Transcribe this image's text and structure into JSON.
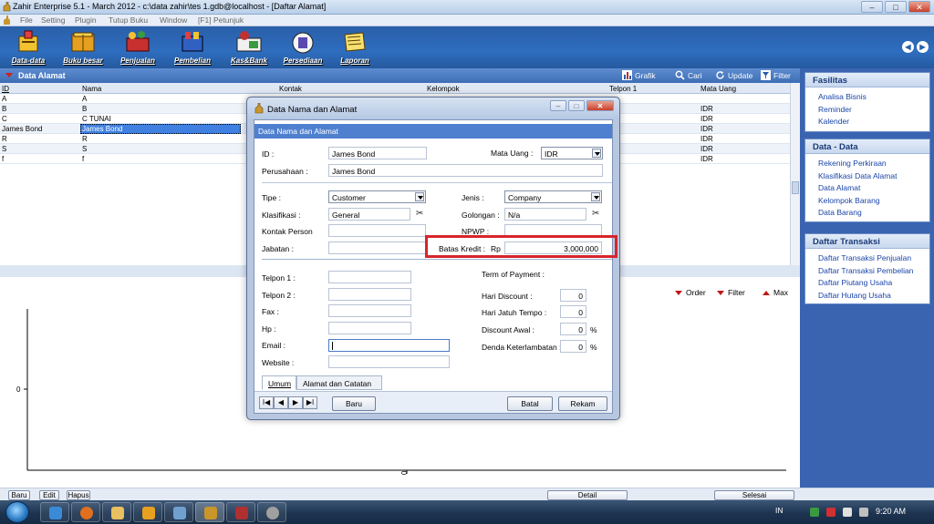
{
  "window": {
    "title": "Zahir Enterprise 5.1 - March 2012 - c:\\data zahir\\tes 1.gdb@localhost - [Daftar Alamat]"
  },
  "menu": [
    "File",
    "Setting",
    "Plugin",
    "Tutup Buku",
    "Window",
    "[F1] Petunjuk"
  ],
  "toolbar": [
    {
      "label": "Data-data",
      "icon": "data-icon"
    },
    {
      "label": "Buku besar",
      "icon": "ledger-icon"
    },
    {
      "label": "Penjualan",
      "icon": "sales-icon"
    },
    {
      "label": "Pembelian",
      "icon": "purchase-icon"
    },
    {
      "label": "Kas&Bank",
      "icon": "cash-bank-icon"
    },
    {
      "label": "Persediaan",
      "icon": "inventory-icon"
    },
    {
      "label": "Laporan",
      "icon": "report-icon"
    }
  ],
  "panel": {
    "title": "Data Alamat",
    "tools": {
      "grafik": "Grafik",
      "cari": "Cari",
      "update": "Update",
      "filter": "Filter"
    },
    "columns": [
      "ID",
      "Nama",
      "Kontak",
      "Kelompok",
      "Telpon 1",
      "Mata Uang"
    ],
    "rows": [
      {
        "id": "A",
        "nama": "A",
        "uang": ""
      },
      {
        "id": "B",
        "nama": "B",
        "uang": "IDR"
      },
      {
        "id": "C",
        "nama": "C TUNAI",
        "uang": "IDR"
      },
      {
        "id": "James Bond",
        "nama": "James Bond",
        "uang": "IDR"
      },
      {
        "id": "R",
        "nama": "R",
        "uang": "IDR"
      },
      {
        "id": "S",
        "nama": "S",
        "uang": "IDR"
      },
      {
        "id": "f",
        "nama": "f",
        "uang": "IDR"
      }
    ]
  },
  "chart": {
    "legend": {
      "order": "Order",
      "filter": "Filter",
      "max": "Max"
    },
    "y_tick": "0",
    "x_tick": "0"
  },
  "bottom": {
    "baru": "Baru",
    "edit": "Edit",
    "hapus": "Hapus",
    "detail": "Detail",
    "selesai": "Selesai"
  },
  "sidebar": {
    "fasilitas": {
      "title": "Fasilitas",
      "items": [
        "Analisa Bisnis",
        "Reminder",
        "Kalender"
      ]
    },
    "datadata": {
      "title": "Data - Data",
      "items": [
        "Rekening Perkiraan",
        "Klasifikasi Data Alamat",
        "Data Alamat",
        "Kelompok Barang",
        "Data Barang"
      ]
    },
    "transaksi": {
      "title": "Daftar Transaksi",
      "items": [
        "Daftar Transaksi Penjualan",
        "Daftar Transaksi Pembelian",
        "Daftar Piutang Usaha",
        "Daftar Hutang Usaha"
      ]
    }
  },
  "dialog": {
    "title": "Data Nama dan Alamat",
    "header": "Data Nama dan Alamat",
    "fields": {
      "id_label": "ID :",
      "id_value": "James Bond",
      "matauang_label": "Mata Uang :",
      "matauang_value": "IDR",
      "perusahaan_label": "Perusahaan :",
      "perusahaan_value": "James Bond",
      "tipe_label": "Tipe :",
      "tipe_value": "Customer",
      "jenis_label": "Jenis :",
      "jenis_value": "Company",
      "klasifikasi_label": "Klasifikasi :",
      "klasifikasi_value": "General",
      "golongan_label": "Golongan :",
      "golongan_value": "N/a",
      "kontak_label": "Kontak Person",
      "kontak_value": "",
      "npwp_label": "NPWP :",
      "npwp_value": "",
      "jabatan_label": "Jabatan :",
      "jabatan_value": "",
      "batas_label": "Batas Kredit :",
      "batas_currency": "Rp",
      "batas_value": "3,000,000",
      "telpon1_label": "Telpon 1 :",
      "telpon2_label": "Telpon 2 :",
      "fax_label": "Fax :",
      "hp_label": "Hp :",
      "email_label": "Email :",
      "website_label": "Website :",
      "term_label": "Term of Payment :",
      "hari_discount_label": "Hari Discount :",
      "hari_discount_value": "0",
      "jatuh_tempo_label": "Hari Jatuh Tempo :",
      "jatuh_tempo_value": "0",
      "discount_awal_label": "Discount Awal :",
      "discount_awal_value": "0",
      "denda_label": "Denda Keterlambatan :",
      "denda_value": "0",
      "percent": "%"
    },
    "tabs": [
      "Umum",
      "Alamat dan Catatan"
    ],
    "buttons": {
      "baru": "Baru",
      "batal": "Batal",
      "rekam": "Rekam"
    }
  },
  "taskbar": {
    "lang": "IN",
    "time": "9:20 AM"
  }
}
